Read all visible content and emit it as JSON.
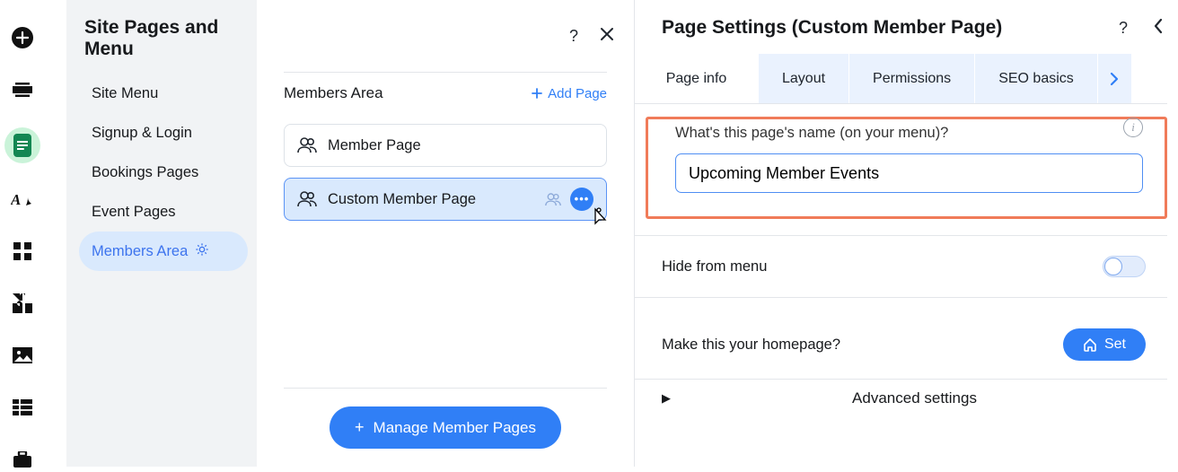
{
  "left_toolbar": {
    "icons": [
      "add",
      "sections",
      "pages",
      "text-style",
      "apps",
      "plugins",
      "media",
      "table",
      "business"
    ]
  },
  "sidebar": {
    "title": "Site Pages and Menu",
    "items": [
      {
        "label": "Site Menu"
      },
      {
        "label": "Signup & Login"
      },
      {
        "label": "Bookings Pages"
      },
      {
        "label": "Event Pages"
      },
      {
        "label": "Members Area",
        "active": true
      }
    ]
  },
  "pagelist": {
    "heading": "Members Area",
    "add_label": "Add Page",
    "items": [
      {
        "label": "Member Page",
        "selected": false
      },
      {
        "label": "Custom Member Page",
        "selected": true
      }
    ],
    "manage_button": "Manage Member Pages"
  },
  "settings": {
    "title": "Page Settings (Custom Member Page)",
    "tabs": [
      {
        "label": "Page info",
        "active": true
      },
      {
        "label": "Layout"
      },
      {
        "label": "Permissions"
      },
      {
        "label": "SEO basics"
      }
    ],
    "name_field": {
      "label": "What's this page's name (on your menu)?",
      "value": "Upcoming Member Events"
    },
    "hide_from_menu": {
      "label": "Hide from menu",
      "on": false
    },
    "homepage": {
      "label": "Make this your homepage?",
      "button": "Set"
    },
    "advanced_label": "Advanced settings"
  }
}
